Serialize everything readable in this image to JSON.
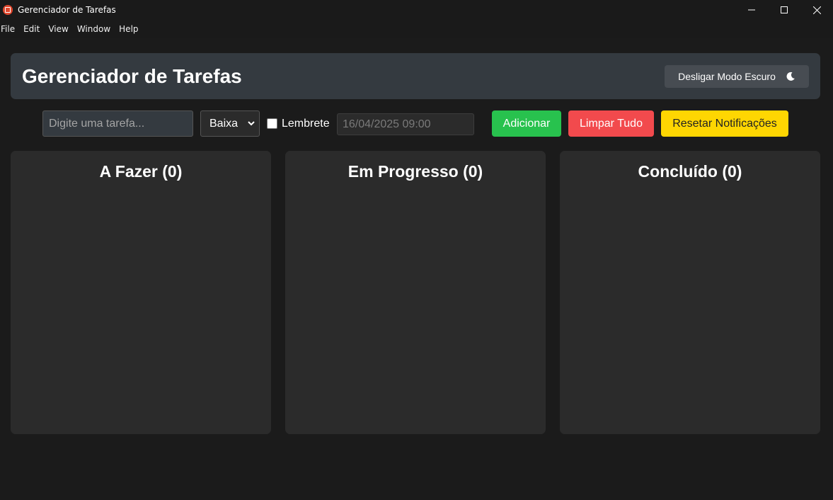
{
  "window": {
    "title": "Gerenciador de Tarefas"
  },
  "menu": [
    "File",
    "Edit",
    "View",
    "Window",
    "Help"
  ],
  "header": {
    "title": "Gerenciador de Tarefas",
    "dark_mode_button": "Desligar Modo Escuro"
  },
  "form": {
    "task_placeholder": "Digite uma tarefa...",
    "priority_selected": "Baixa",
    "reminder_label": "Lembrete",
    "reminder_checked": false,
    "datetime_value": "16/04/2025 09:00",
    "add_button": "Adicionar",
    "clear_button": "Limpar Tudo",
    "reset_button": "Resetar Notificações"
  },
  "columns": [
    {
      "title": "A Fazer (0)"
    },
    {
      "title": "Em Progresso (0)"
    },
    {
      "title": "Concluído (0)"
    }
  ],
  "colors": {
    "add": "#28c24e",
    "clear": "#f24a4d",
    "reset": "#fed602",
    "header_bg": "#343a40",
    "column_bg": "#2b2b2b"
  }
}
